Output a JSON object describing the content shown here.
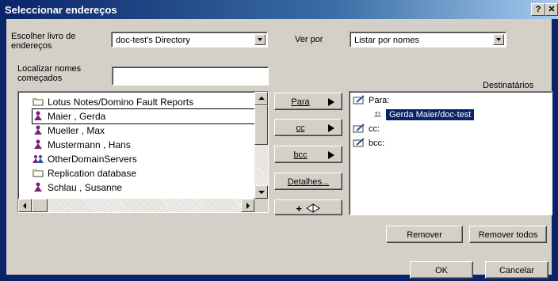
{
  "window": {
    "title": "Seleccionar endereços",
    "help_label": "?",
    "close_label": "✕"
  },
  "address_book": {
    "label_line1": "Escolher livro de",
    "label_line2": "endereços",
    "selected": "doc-test's Directory"
  },
  "view_by": {
    "label": "Ver por",
    "selected": "Listar por nomes"
  },
  "find": {
    "label_line1": "Localizar nomes",
    "label_line2": "começados",
    "value": ""
  },
  "names_list": {
    "items": [
      {
        "label": "Lotus Notes/Domino Fault Reports",
        "icon": "folder-icon"
      },
      {
        "label": "Maier , Gerda",
        "icon": "person-icon"
      },
      {
        "label": "Mueller , Max",
        "icon": "person-icon"
      },
      {
        "label": "Mustermann , Hans",
        "icon": "person-icon"
      },
      {
        "label": "OtherDomainServers",
        "icon": "group-icon"
      },
      {
        "label": "Replication database",
        "icon": "folder-icon"
      },
      {
        "label": "Schlau , Susanne",
        "icon": "person-icon"
      }
    ],
    "focused_index": 1
  },
  "actions": {
    "to_label": "Para",
    "cc_label": "cc",
    "bcc_label": "bcc",
    "details_label": "Detalhes...",
    "add_label": "+"
  },
  "recipients": {
    "header": "Destinatários",
    "to_label": "Para:",
    "to_entries": [
      "Gerda Maier/doc-test"
    ],
    "cc_label": "cc:",
    "bcc_label": "bcc:"
  },
  "buttons": {
    "remove": "Remover",
    "remove_all": "Remover todos",
    "ok": "OK",
    "cancel": "Cancelar"
  },
  "colors": {
    "title_bar": "#0a246a",
    "selection": "#0a246a",
    "face": "#d4d0c8"
  }
}
